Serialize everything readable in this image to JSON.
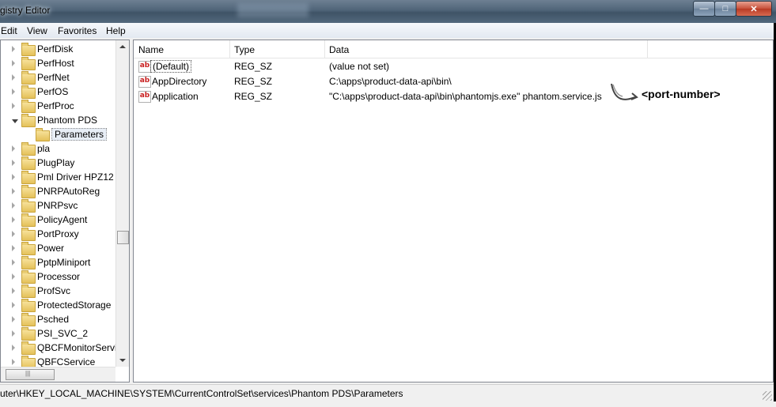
{
  "window": {
    "title": "gistry Editor",
    "buttons": {
      "minimize": "—",
      "maximize": "□",
      "close": "✕"
    }
  },
  "menu": [
    "Edit",
    "View",
    "Favorites",
    "Help"
  ],
  "tree": {
    "items": [
      {
        "label": "PerfDisk",
        "level": 1,
        "expander": "closed"
      },
      {
        "label": "PerfHost",
        "level": 1,
        "expander": "closed"
      },
      {
        "label": "PerfNet",
        "level": 1,
        "expander": "closed"
      },
      {
        "label": "PerfOS",
        "level": 1,
        "expander": "closed"
      },
      {
        "label": "PerfProc",
        "level": 1,
        "expander": "closed"
      },
      {
        "label": "Phantom PDS",
        "level": 1,
        "expander": "open"
      },
      {
        "label": "Parameters",
        "level": 2,
        "expander": "none",
        "selected": true
      },
      {
        "label": "pla",
        "level": 1,
        "expander": "closed"
      },
      {
        "label": "PlugPlay",
        "level": 1,
        "expander": "closed"
      },
      {
        "label": "Pml Driver HPZ12",
        "level": 1,
        "expander": "closed"
      },
      {
        "label": "PNRPAutoReg",
        "level": 1,
        "expander": "closed"
      },
      {
        "label": "PNRPsvc",
        "level": 1,
        "expander": "closed"
      },
      {
        "label": "PolicyAgent",
        "level": 1,
        "expander": "closed"
      },
      {
        "label": "PortProxy",
        "level": 1,
        "expander": "closed"
      },
      {
        "label": "Power",
        "level": 1,
        "expander": "closed"
      },
      {
        "label": "PptpMiniport",
        "level": 1,
        "expander": "closed"
      },
      {
        "label": "Processor",
        "level": 1,
        "expander": "closed"
      },
      {
        "label": "ProfSvc",
        "level": 1,
        "expander": "closed"
      },
      {
        "label": "ProtectedStorage",
        "level": 1,
        "expander": "closed"
      },
      {
        "label": "Psched",
        "level": 1,
        "expander": "closed"
      },
      {
        "label": "PSI_SVC_2",
        "level": 1,
        "expander": "closed"
      },
      {
        "label": "QBCFMonitorServi",
        "level": 1,
        "expander": "closed"
      },
      {
        "label": "QBFCService",
        "level": 1,
        "expander": "closed"
      }
    ],
    "hscroll_grip": "|||"
  },
  "list": {
    "columns": [
      "Name",
      "Type",
      "Data"
    ],
    "rows": [
      {
        "icon": "ab",
        "name": "(Default)",
        "type": "REG_SZ",
        "data": "(value not set)"
      },
      {
        "icon": "ab",
        "name": "AppDirectory",
        "type": "REG_SZ",
        "data": "C:\\apps\\product-data-api\\bin\\"
      },
      {
        "icon": "ab",
        "name": "Application",
        "type": "REG_SZ",
        "data": "\"C:\\apps\\product-data-api\\bin\\phantomjs.exe\" phantom.service.js"
      }
    ],
    "annotation": "<port-number>"
  },
  "status": {
    "path": "uter\\HKEY_LOCAL_MACHINE\\SYSTEM\\CurrentControlSet\\services\\Phantom PDS\\Parameters"
  },
  "icons": {
    "value": "string-value-icon",
    "folder": "folder-icon",
    "arrow": "hand-drawn-arrow-icon"
  }
}
